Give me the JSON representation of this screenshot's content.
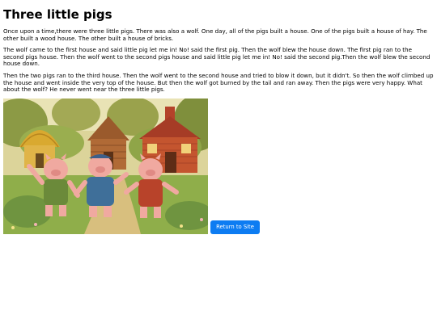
{
  "page": {
    "title": "Three little pigs",
    "paragraphs": [
      "Once upon a time,there were three little pigs. There was also a wolf. One day, all of the pigs built a house. One of the pigs built a house of hay. The other built a wood house. The other built a house of bricks.",
      "The wolf came to the first house and said little pig let me in! No! said the first pig. Then the wolf blew the house down. The first pig ran to the second pigs house. Then the wolf went to the second pigs house and said little pig let me in! No! said the second pig.Then the wolf blew the second house down.",
      "Then the two pigs ran to the third house. Then the wolf went to the second house and tried to blow it down, but it didn't. So then the wolf climbed up the house and went inside the very top of the house. But then the wolf got burned by the tail and ran away. Then the pigs were very happy. What about the wolf? He never went near the three little pigs."
    ],
    "return_button": "Return to Site"
  },
  "colors": {
    "button": "#0d7cf2"
  }
}
